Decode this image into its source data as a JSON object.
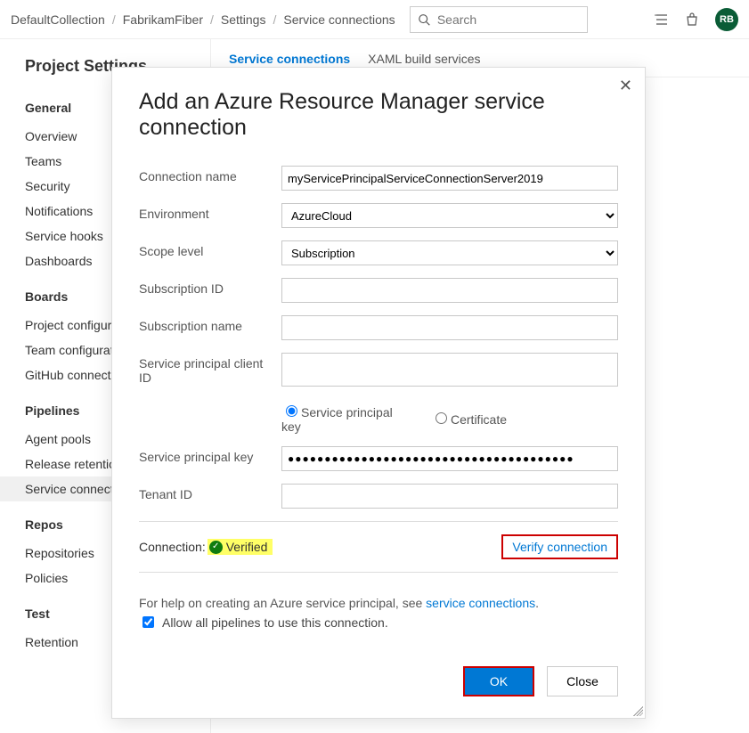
{
  "breadcrumbs": [
    "DefaultCollection",
    "FabrikamFiber",
    "Settings",
    "Service connections"
  ],
  "breadcrumb_sep": "/",
  "search": {
    "placeholder": "Search"
  },
  "avatar": "RB",
  "sidebar": {
    "title": "Project Settings",
    "sections": [
      {
        "label": "General",
        "items": [
          "Overview",
          "Teams",
          "Security",
          "Notifications",
          "Service hooks",
          "Dashboards"
        ]
      },
      {
        "label": "Boards",
        "items": [
          "Project configuration",
          "Team configuration",
          "GitHub connections"
        ]
      },
      {
        "label": "Pipelines",
        "items": [
          "Agent pools",
          "Release retention",
          "Service connections"
        ]
      },
      {
        "label": "Repos",
        "items": [
          "Repositories",
          "Policies"
        ]
      },
      {
        "label": "Test",
        "items": [
          "Retention"
        ]
      }
    ],
    "selected": "Service connections"
  },
  "tabs": [
    {
      "label": "Service connections",
      "active": true
    },
    {
      "label": "XAML build services",
      "active": false
    }
  ],
  "dialog": {
    "title": "Add an Azure Resource Manager service connection",
    "fields": {
      "connection_name": {
        "label": "Connection name",
        "value": "myServicePrincipalServiceConnectionServer2019"
      },
      "environment": {
        "label": "Environment",
        "value": "AzureCloud"
      },
      "scope_level": {
        "label": "Scope level",
        "value": "Subscription"
      },
      "subscription_id": {
        "label": "Subscription ID",
        "value": ""
      },
      "subscription_name": {
        "label": "Subscription name",
        "value": ""
      },
      "sp_client_id": {
        "label": "Service principal client ID",
        "value": ""
      },
      "auth_options": {
        "key": "Service principal key",
        "cert": "Certificate",
        "selected": "key"
      },
      "sp_key": {
        "label": "Service principal key",
        "value": "●●●●●●●●●●●●●●●●●●●●●●●●●●●●●●●●●●●●●●●"
      },
      "tenant_id": {
        "label": "Tenant ID",
        "value": ""
      }
    },
    "connection_status": {
      "label": "Connection:",
      "state": "Verified"
    },
    "verify_link": "Verify connection",
    "help": {
      "prefix": "For help on creating an Azure service principal, see ",
      "link": "service connections",
      "suffix": "."
    },
    "allow_all": {
      "label": "Allow all pipelines to use this connection.",
      "checked": true
    },
    "buttons": {
      "ok": "OK",
      "close": "Close"
    }
  }
}
